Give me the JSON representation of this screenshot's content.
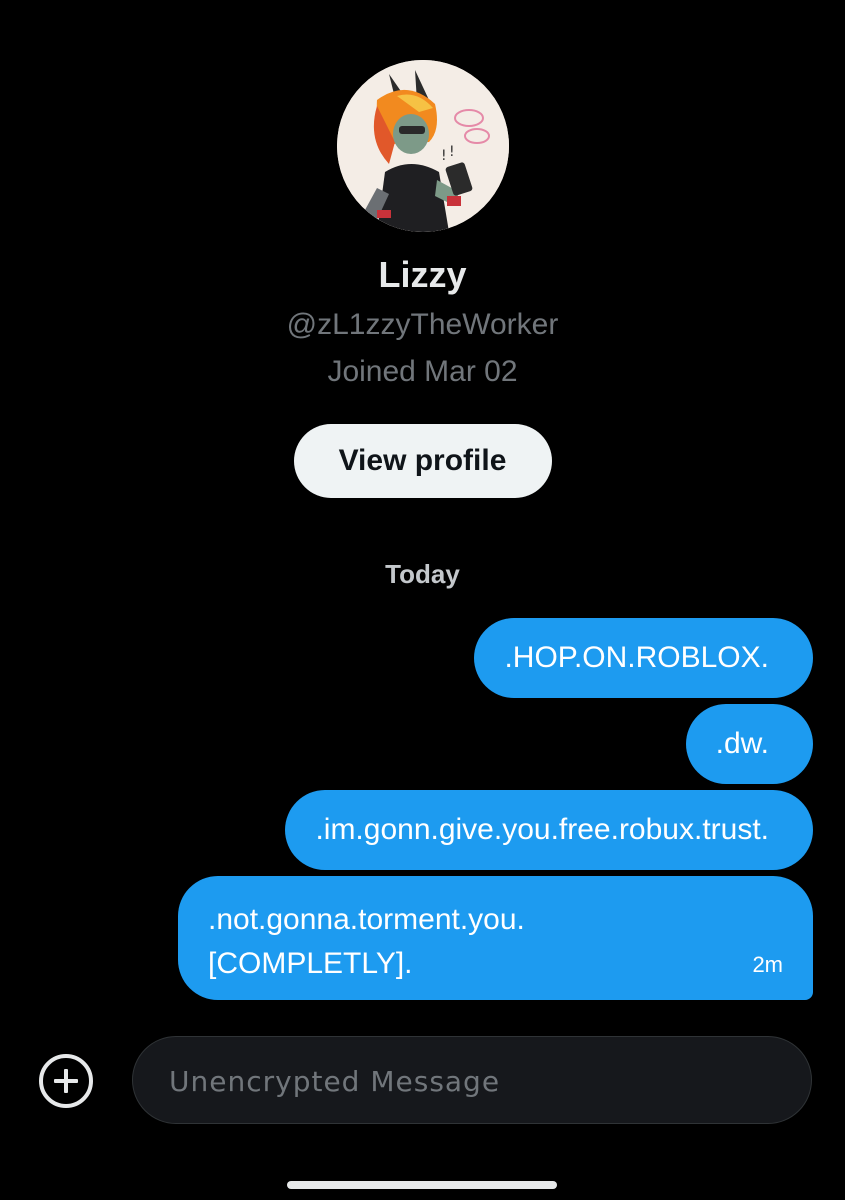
{
  "profile": {
    "display_name": "Lizzy",
    "handle": "@zL1zzyTheWorker",
    "joined": "Joined Mar 02",
    "view_profile_label": "View profile"
  },
  "conversation": {
    "date_divider": "Today",
    "messages": [
      {
        "text": ".HOP.ON.ROBLOX.",
        "sender": "me"
      },
      {
        "text": ".dw.",
        "sender": "me"
      },
      {
        "text": ".im.gonn.give.you.free.robux.trust.",
        "sender": "me"
      },
      {
        "text": ".not.gonna.torment.you. [COMPLETLY].",
        "sender": "me",
        "timestamp": "2m"
      }
    ]
  },
  "composer": {
    "placeholder": "Unencrypted Message",
    "add_icon": "plus-circle-icon"
  },
  "colors": {
    "background": "#000000",
    "bubble": "#1d9bf0",
    "secondary_text": "#71767b",
    "button_bg": "#eff3f4"
  }
}
